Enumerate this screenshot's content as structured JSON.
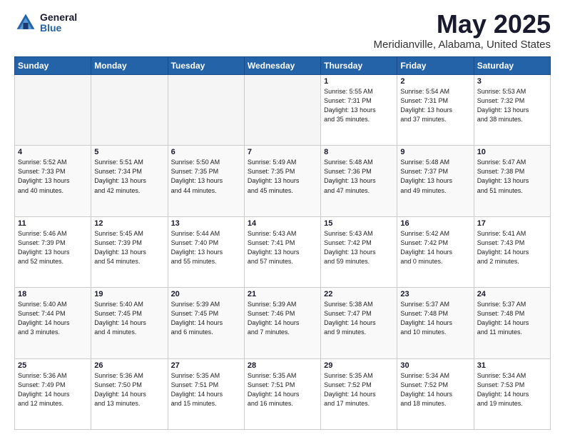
{
  "header": {
    "logo_general": "General",
    "logo_blue": "Blue",
    "month_title": "May 2025",
    "location": "Meridianville, Alabama, United States"
  },
  "days_of_week": [
    "Sunday",
    "Monday",
    "Tuesday",
    "Wednesday",
    "Thursday",
    "Friday",
    "Saturday"
  ],
  "weeks": [
    [
      {
        "day": "",
        "info": ""
      },
      {
        "day": "",
        "info": ""
      },
      {
        "day": "",
        "info": ""
      },
      {
        "day": "",
        "info": ""
      },
      {
        "day": "1",
        "info": "Sunrise: 5:55 AM\nSunset: 7:31 PM\nDaylight: 13 hours\nand 35 minutes."
      },
      {
        "day": "2",
        "info": "Sunrise: 5:54 AM\nSunset: 7:31 PM\nDaylight: 13 hours\nand 37 minutes."
      },
      {
        "day": "3",
        "info": "Sunrise: 5:53 AM\nSunset: 7:32 PM\nDaylight: 13 hours\nand 38 minutes."
      }
    ],
    [
      {
        "day": "4",
        "info": "Sunrise: 5:52 AM\nSunset: 7:33 PM\nDaylight: 13 hours\nand 40 minutes."
      },
      {
        "day": "5",
        "info": "Sunrise: 5:51 AM\nSunset: 7:34 PM\nDaylight: 13 hours\nand 42 minutes."
      },
      {
        "day": "6",
        "info": "Sunrise: 5:50 AM\nSunset: 7:35 PM\nDaylight: 13 hours\nand 44 minutes."
      },
      {
        "day": "7",
        "info": "Sunrise: 5:49 AM\nSunset: 7:35 PM\nDaylight: 13 hours\nand 45 minutes."
      },
      {
        "day": "8",
        "info": "Sunrise: 5:48 AM\nSunset: 7:36 PM\nDaylight: 13 hours\nand 47 minutes."
      },
      {
        "day": "9",
        "info": "Sunrise: 5:48 AM\nSunset: 7:37 PM\nDaylight: 13 hours\nand 49 minutes."
      },
      {
        "day": "10",
        "info": "Sunrise: 5:47 AM\nSunset: 7:38 PM\nDaylight: 13 hours\nand 51 minutes."
      }
    ],
    [
      {
        "day": "11",
        "info": "Sunrise: 5:46 AM\nSunset: 7:39 PM\nDaylight: 13 hours\nand 52 minutes."
      },
      {
        "day": "12",
        "info": "Sunrise: 5:45 AM\nSunset: 7:39 PM\nDaylight: 13 hours\nand 54 minutes."
      },
      {
        "day": "13",
        "info": "Sunrise: 5:44 AM\nSunset: 7:40 PM\nDaylight: 13 hours\nand 55 minutes."
      },
      {
        "day": "14",
        "info": "Sunrise: 5:43 AM\nSunset: 7:41 PM\nDaylight: 13 hours\nand 57 minutes."
      },
      {
        "day": "15",
        "info": "Sunrise: 5:43 AM\nSunset: 7:42 PM\nDaylight: 13 hours\nand 59 minutes."
      },
      {
        "day": "16",
        "info": "Sunrise: 5:42 AM\nSunset: 7:42 PM\nDaylight: 14 hours\nand 0 minutes."
      },
      {
        "day": "17",
        "info": "Sunrise: 5:41 AM\nSunset: 7:43 PM\nDaylight: 14 hours\nand 2 minutes."
      }
    ],
    [
      {
        "day": "18",
        "info": "Sunrise: 5:40 AM\nSunset: 7:44 PM\nDaylight: 14 hours\nand 3 minutes."
      },
      {
        "day": "19",
        "info": "Sunrise: 5:40 AM\nSunset: 7:45 PM\nDaylight: 14 hours\nand 4 minutes."
      },
      {
        "day": "20",
        "info": "Sunrise: 5:39 AM\nSunset: 7:45 PM\nDaylight: 14 hours\nand 6 minutes."
      },
      {
        "day": "21",
        "info": "Sunrise: 5:39 AM\nSunset: 7:46 PM\nDaylight: 14 hours\nand 7 minutes."
      },
      {
        "day": "22",
        "info": "Sunrise: 5:38 AM\nSunset: 7:47 PM\nDaylight: 14 hours\nand 9 minutes."
      },
      {
        "day": "23",
        "info": "Sunrise: 5:37 AM\nSunset: 7:48 PM\nDaylight: 14 hours\nand 10 minutes."
      },
      {
        "day": "24",
        "info": "Sunrise: 5:37 AM\nSunset: 7:48 PM\nDaylight: 14 hours\nand 11 minutes."
      }
    ],
    [
      {
        "day": "25",
        "info": "Sunrise: 5:36 AM\nSunset: 7:49 PM\nDaylight: 14 hours\nand 12 minutes."
      },
      {
        "day": "26",
        "info": "Sunrise: 5:36 AM\nSunset: 7:50 PM\nDaylight: 14 hours\nand 13 minutes."
      },
      {
        "day": "27",
        "info": "Sunrise: 5:35 AM\nSunset: 7:51 PM\nDaylight: 14 hours\nand 15 minutes."
      },
      {
        "day": "28",
        "info": "Sunrise: 5:35 AM\nSunset: 7:51 PM\nDaylight: 14 hours\nand 16 minutes."
      },
      {
        "day": "29",
        "info": "Sunrise: 5:35 AM\nSunset: 7:52 PM\nDaylight: 14 hours\nand 17 minutes."
      },
      {
        "day": "30",
        "info": "Sunrise: 5:34 AM\nSunset: 7:52 PM\nDaylight: 14 hours\nand 18 minutes."
      },
      {
        "day": "31",
        "info": "Sunrise: 5:34 AM\nSunset: 7:53 PM\nDaylight: 14 hours\nand 19 minutes."
      }
    ]
  ]
}
